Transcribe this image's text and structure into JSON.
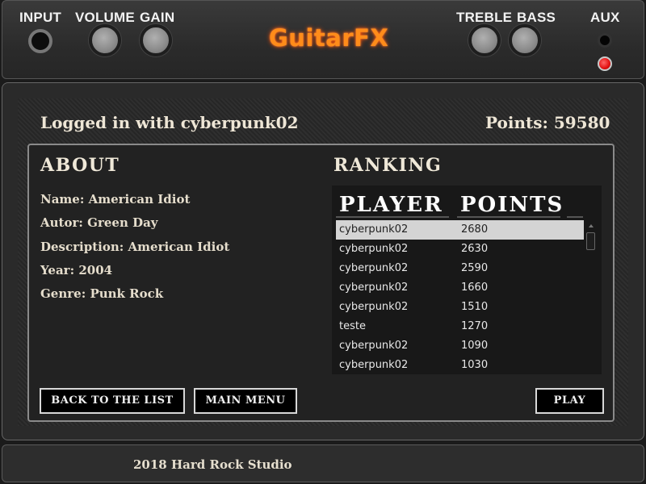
{
  "amp": {
    "input_label": "INPUT",
    "volume_label": "VOLUME",
    "gain_label": "GAIN",
    "treble_label": "TREBLE",
    "bass_label": "BASS",
    "aux_label": "AUX",
    "logo": "GuitarFX",
    "logo_color": "#ff8c1a"
  },
  "status": {
    "logged_in": "Logged in with cyberpunk02",
    "points": "Points: 59580"
  },
  "about": {
    "title": "ABOUT",
    "name": "Name: American Idiot",
    "author": "Autor: Green Day",
    "description": "Description: American Idiot",
    "year": "Year: 2004",
    "genre": "Genre: Punk Rock"
  },
  "ranking": {
    "title": "RANKING",
    "columns": [
      "PLAYER",
      "POINTS"
    ],
    "rows": [
      {
        "player": "cyberpunk02",
        "points": "2680"
      },
      {
        "player": "cyberpunk02",
        "points": "2630"
      },
      {
        "player": "cyberpunk02",
        "points": "2590"
      },
      {
        "player": "cyberpunk02",
        "points": "1660"
      },
      {
        "player": "cyberpunk02",
        "points": "1510"
      },
      {
        "player": "teste",
        "points": "1270"
      },
      {
        "player": "cyberpunk02",
        "points": "1090"
      },
      {
        "player": "cyberpunk02",
        "points": "1030"
      }
    ]
  },
  "buttons": {
    "back": "BACK TO THE LIST",
    "main_menu": "MAIN MENU",
    "play": "PLAY"
  },
  "footer": "2018 Hard Rock Studio"
}
